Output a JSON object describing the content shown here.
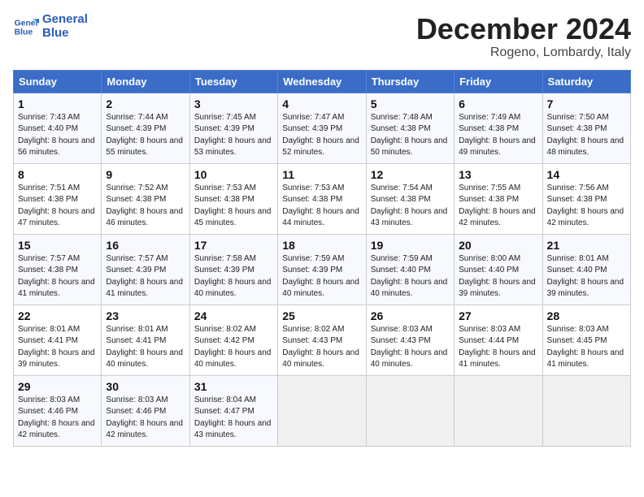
{
  "logo": {
    "line1": "General",
    "line2": "Blue"
  },
  "title": "December 2024",
  "subtitle": "Rogeno, Lombardy, Italy",
  "weekdays": [
    "Sunday",
    "Monday",
    "Tuesday",
    "Wednesday",
    "Thursday",
    "Friday",
    "Saturday"
  ],
  "weeks": [
    [
      {
        "day": "1",
        "sunrise": "Sunrise: 7:43 AM",
        "sunset": "Sunset: 4:40 PM",
        "daylight": "Daylight: 8 hours and 56 minutes."
      },
      {
        "day": "2",
        "sunrise": "Sunrise: 7:44 AM",
        "sunset": "Sunset: 4:39 PM",
        "daylight": "Daylight: 8 hours and 55 minutes."
      },
      {
        "day": "3",
        "sunrise": "Sunrise: 7:45 AM",
        "sunset": "Sunset: 4:39 PM",
        "daylight": "Daylight: 8 hours and 53 minutes."
      },
      {
        "day": "4",
        "sunrise": "Sunrise: 7:47 AM",
        "sunset": "Sunset: 4:39 PM",
        "daylight": "Daylight: 8 hours and 52 minutes."
      },
      {
        "day": "5",
        "sunrise": "Sunrise: 7:48 AM",
        "sunset": "Sunset: 4:38 PM",
        "daylight": "Daylight: 8 hours and 50 minutes."
      },
      {
        "day": "6",
        "sunrise": "Sunrise: 7:49 AM",
        "sunset": "Sunset: 4:38 PM",
        "daylight": "Daylight: 8 hours and 49 minutes."
      },
      {
        "day": "7",
        "sunrise": "Sunrise: 7:50 AM",
        "sunset": "Sunset: 4:38 PM",
        "daylight": "Daylight: 8 hours and 48 minutes."
      }
    ],
    [
      {
        "day": "8",
        "sunrise": "Sunrise: 7:51 AM",
        "sunset": "Sunset: 4:38 PM",
        "daylight": "Daylight: 8 hours and 47 minutes."
      },
      {
        "day": "9",
        "sunrise": "Sunrise: 7:52 AM",
        "sunset": "Sunset: 4:38 PM",
        "daylight": "Daylight: 8 hours and 46 minutes."
      },
      {
        "day": "10",
        "sunrise": "Sunrise: 7:53 AM",
        "sunset": "Sunset: 4:38 PM",
        "daylight": "Daylight: 8 hours and 45 minutes."
      },
      {
        "day": "11",
        "sunrise": "Sunrise: 7:53 AM",
        "sunset": "Sunset: 4:38 PM",
        "daylight": "Daylight: 8 hours and 44 minutes."
      },
      {
        "day": "12",
        "sunrise": "Sunrise: 7:54 AM",
        "sunset": "Sunset: 4:38 PM",
        "daylight": "Daylight: 8 hours and 43 minutes."
      },
      {
        "day": "13",
        "sunrise": "Sunrise: 7:55 AM",
        "sunset": "Sunset: 4:38 PM",
        "daylight": "Daylight: 8 hours and 42 minutes."
      },
      {
        "day": "14",
        "sunrise": "Sunrise: 7:56 AM",
        "sunset": "Sunset: 4:38 PM",
        "daylight": "Daylight: 8 hours and 42 minutes."
      }
    ],
    [
      {
        "day": "15",
        "sunrise": "Sunrise: 7:57 AM",
        "sunset": "Sunset: 4:38 PM",
        "daylight": "Daylight: 8 hours and 41 minutes."
      },
      {
        "day": "16",
        "sunrise": "Sunrise: 7:57 AM",
        "sunset": "Sunset: 4:39 PM",
        "daylight": "Daylight: 8 hours and 41 minutes."
      },
      {
        "day": "17",
        "sunrise": "Sunrise: 7:58 AM",
        "sunset": "Sunset: 4:39 PM",
        "daylight": "Daylight: 8 hours and 40 minutes."
      },
      {
        "day": "18",
        "sunrise": "Sunrise: 7:59 AM",
        "sunset": "Sunset: 4:39 PM",
        "daylight": "Daylight: 8 hours and 40 minutes."
      },
      {
        "day": "19",
        "sunrise": "Sunrise: 7:59 AM",
        "sunset": "Sunset: 4:40 PM",
        "daylight": "Daylight: 8 hours and 40 minutes."
      },
      {
        "day": "20",
        "sunrise": "Sunrise: 8:00 AM",
        "sunset": "Sunset: 4:40 PM",
        "daylight": "Daylight: 8 hours and 39 minutes."
      },
      {
        "day": "21",
        "sunrise": "Sunrise: 8:01 AM",
        "sunset": "Sunset: 4:40 PM",
        "daylight": "Daylight: 8 hours and 39 minutes."
      }
    ],
    [
      {
        "day": "22",
        "sunrise": "Sunrise: 8:01 AM",
        "sunset": "Sunset: 4:41 PM",
        "daylight": "Daylight: 8 hours and 39 minutes."
      },
      {
        "day": "23",
        "sunrise": "Sunrise: 8:01 AM",
        "sunset": "Sunset: 4:41 PM",
        "daylight": "Daylight: 8 hours and 40 minutes."
      },
      {
        "day": "24",
        "sunrise": "Sunrise: 8:02 AM",
        "sunset": "Sunset: 4:42 PM",
        "daylight": "Daylight: 8 hours and 40 minutes."
      },
      {
        "day": "25",
        "sunrise": "Sunrise: 8:02 AM",
        "sunset": "Sunset: 4:43 PM",
        "daylight": "Daylight: 8 hours and 40 minutes."
      },
      {
        "day": "26",
        "sunrise": "Sunrise: 8:03 AM",
        "sunset": "Sunset: 4:43 PM",
        "daylight": "Daylight: 8 hours and 40 minutes."
      },
      {
        "day": "27",
        "sunrise": "Sunrise: 8:03 AM",
        "sunset": "Sunset: 4:44 PM",
        "daylight": "Daylight: 8 hours and 41 minutes."
      },
      {
        "day": "28",
        "sunrise": "Sunrise: 8:03 AM",
        "sunset": "Sunset: 4:45 PM",
        "daylight": "Daylight: 8 hours and 41 minutes."
      }
    ],
    [
      {
        "day": "29",
        "sunrise": "Sunrise: 8:03 AM",
        "sunset": "Sunset: 4:46 PM",
        "daylight": "Daylight: 8 hours and 42 minutes."
      },
      {
        "day": "30",
        "sunrise": "Sunrise: 8:03 AM",
        "sunset": "Sunset: 4:46 PM",
        "daylight": "Daylight: 8 hours and 42 minutes."
      },
      {
        "day": "31",
        "sunrise": "Sunrise: 8:04 AM",
        "sunset": "Sunset: 4:47 PM",
        "daylight": "Daylight: 8 hours and 43 minutes."
      },
      null,
      null,
      null,
      null
    ]
  ]
}
